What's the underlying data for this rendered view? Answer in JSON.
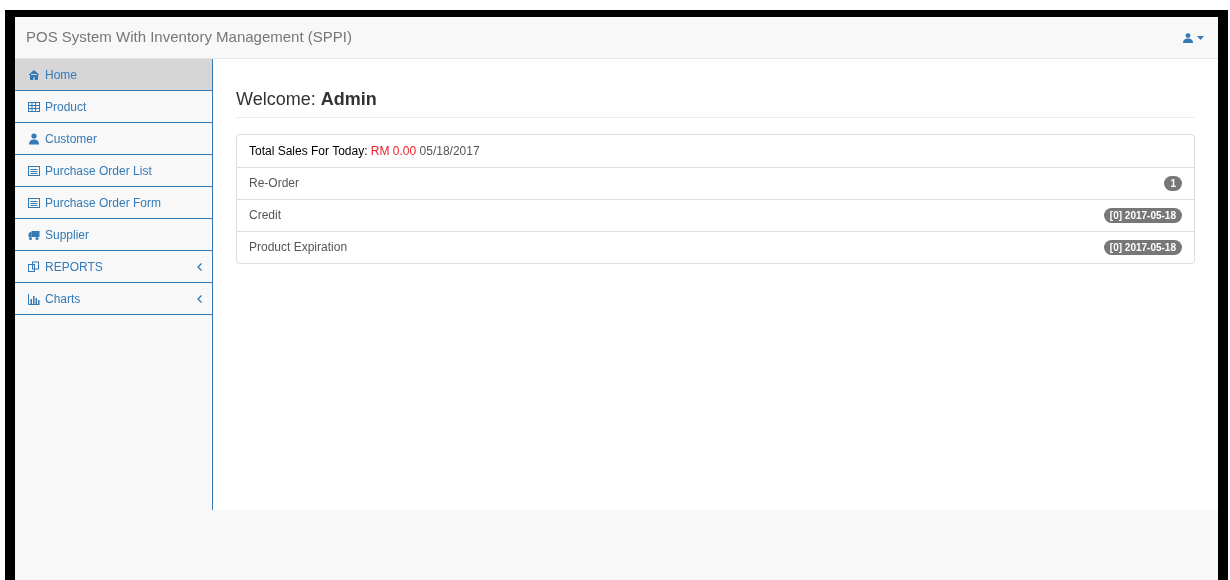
{
  "navbar": {
    "brand": "POS System With Inventory Management (SPPI)"
  },
  "sidebar": {
    "items": [
      {
        "label": "Home",
        "kind": "link",
        "selected": true
      },
      {
        "label": "Product",
        "kind": "link",
        "selected": false
      },
      {
        "label": "Customer",
        "kind": "link",
        "selected": false
      },
      {
        "label": "Purchase Order List",
        "kind": "link",
        "selected": false
      },
      {
        "label": "Purchase Order Form",
        "kind": "link",
        "selected": false
      },
      {
        "label": "Supplier",
        "kind": "link",
        "selected": false
      },
      {
        "label": "REPORTS",
        "kind": "submenu",
        "selected": false
      },
      {
        "label": "Charts",
        "kind": "submenu",
        "selected": false
      }
    ]
  },
  "main": {
    "heading_prefix": "Welcome:",
    "heading_name": "Admin",
    "summary": {
      "label": "Total Sales For Today:",
      "amount": "RM 0.00",
      "date": "05/18/2017"
    },
    "alerts": [
      {
        "label": "Re-Order",
        "badge": "1"
      },
      {
        "label": "Credit",
        "badge": "[0] 2017-05-18"
      },
      {
        "label": "Product Expiration",
        "badge": "[0] 2017-05-18"
      }
    ]
  }
}
